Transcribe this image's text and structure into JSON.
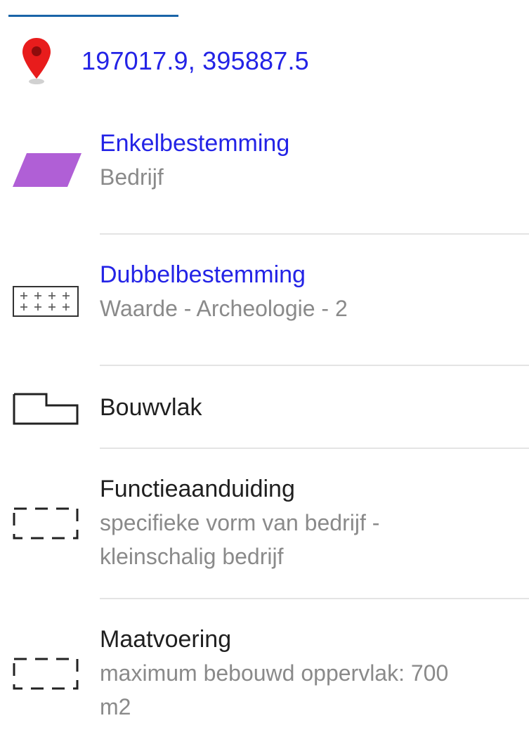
{
  "location": {
    "icon": "map-pin-icon",
    "coordinates": "197017.9, 395887.5",
    "accent": "#2323e6",
    "pin_color": "#e81c1c"
  },
  "items": [
    {
      "icon": "enkelbestemming-swatch-icon",
      "swatch_color": "#b05fd6",
      "title": "Enkelbestemming",
      "subtitle": "Bedrijf"
    },
    {
      "icon": "dubbelbestemming-crosshatch-icon",
      "title": "Dubbelbestemming",
      "subtitle": "Waarde - Archeologie - 2"
    },
    {
      "icon": "bouwvlak-outline-icon",
      "title": "Bouwvlak"
    },
    {
      "icon": "functieaanduiding-dashed-icon",
      "title": "Functieaanduiding",
      "subtitle_line1": "specifieke vorm van bedrijf -",
      "subtitle_line2": "kleinschalig bedrijf"
    },
    {
      "icon": "maatvoering-dashed-icon",
      "title": "Maatvoering",
      "subtitle_line1": "maximum bebouwd oppervlak: 700",
      "subtitle_line2": "m2"
    }
  ]
}
